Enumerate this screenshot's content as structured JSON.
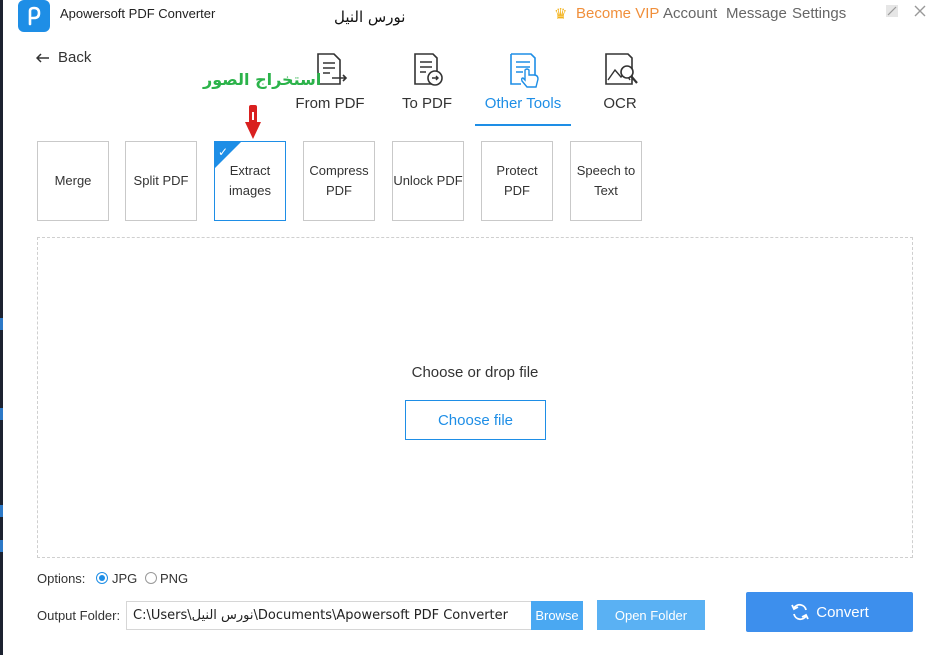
{
  "titlebar": {
    "app_title": "Apowersoft PDF Converter",
    "user_name": "نورس النيل",
    "become_vip": "Become VIP",
    "account": "Account",
    "message": "Message",
    "settings": "Settings",
    "minimize_icon": "minimize-icon",
    "restore_icon": "restore-icon"
  },
  "back": {
    "label": "Back"
  },
  "tabs": [
    {
      "label": "From PDF",
      "icon": "from-pdf-icon",
      "active": false
    },
    {
      "label": "To PDF",
      "icon": "to-pdf-icon",
      "active": false
    },
    {
      "label": "Other Tools",
      "icon": "other-tools-icon",
      "active": true
    },
    {
      "label": "OCR",
      "icon": "ocr-icon",
      "active": false
    }
  ],
  "annotation": {
    "text": "استخراج الصور",
    "color": "#2bb34a",
    "arrow_color": "#d9201f"
  },
  "tools": [
    {
      "label": "Merge",
      "active": false
    },
    {
      "label": "Split PDF",
      "active": false
    },
    {
      "label": "Extract\nimages",
      "active": true
    },
    {
      "label": "Compress\nPDF",
      "active": false
    },
    {
      "label": "Unlock PDF",
      "active": false
    },
    {
      "label": "Protect PDF",
      "active": false
    },
    {
      "label": "Speech to\nText",
      "active": false
    }
  ],
  "dropzone": {
    "prompt": "Choose or drop file",
    "button": "Choose file"
  },
  "options": {
    "label": "Options:",
    "formats": [
      {
        "label": "JPG",
        "selected": true
      },
      {
        "label": "PNG",
        "selected": false
      }
    ]
  },
  "output": {
    "label": "Output Folder:",
    "path": "C:\\Users\\نورس النيل\\Documents\\Apowersoft PDF Converter",
    "browse": "Browse",
    "open_folder": "Open Folder",
    "convert": "Convert"
  },
  "colors": {
    "accent": "#1e8ee6",
    "vip": "#f08f3b",
    "convert": "#3d8fed"
  }
}
